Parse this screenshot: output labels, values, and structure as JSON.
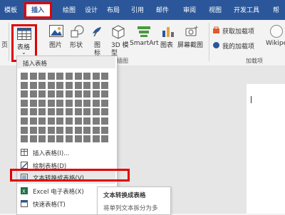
{
  "tabs": [
    {
      "label": "模板"
    },
    {
      "label": "插入"
    },
    {
      "label": "绘图"
    },
    {
      "label": "设计"
    },
    {
      "label": "布局"
    },
    {
      "label": "引用"
    },
    {
      "label": "邮件"
    },
    {
      "label": "审阅"
    },
    {
      "label": "视图"
    },
    {
      "label": "开发工具"
    },
    {
      "label": "帮"
    }
  ],
  "ribbon": {
    "pages_fragment": "页",
    "table": {
      "label": "表格",
      "dropdown_arrow": "⌄"
    },
    "picture": {
      "label": "图片"
    },
    "shapes": {
      "label": "形状"
    },
    "icons": {
      "label": "图",
      "label2": "标"
    },
    "model3d": {
      "label": "3D 模",
      "label2": "型"
    },
    "smartart": {
      "label": "SmartArt"
    },
    "chart": {
      "label": "图表"
    },
    "screenshot": {
      "label": "屏幕截图"
    },
    "get_addins": {
      "label": "获取加载项"
    },
    "my_addins": {
      "label": "我的加载项"
    },
    "wikipedia": {
      "label": "Wikipe"
    },
    "group_illustrations": "插图",
    "group_addins": "加载项"
  },
  "dropdown": {
    "header": "插入表格",
    "grid": {
      "cols": 10,
      "rows": 8
    },
    "items": [
      {
        "label": "插入表格(I)...",
        "icon": "insert-table-icon"
      },
      {
        "label": "绘制表格(D)",
        "icon": "draw-table-icon"
      },
      {
        "label": "文本转换成表格(V)...",
        "icon": "convert-text-icon"
      },
      {
        "label": "Excel 电子表格(X)",
        "icon": "excel-icon"
      },
      {
        "label": "快速表格(T)",
        "icon": "quick-table-icon",
        "arrow": "›"
      }
    ]
  },
  "tooltip": {
    "title": "文本转换成表格",
    "body": "将单列文本拆分为多"
  },
  "colors": {
    "accent": "#2b579a",
    "highlight": "#e00000"
  }
}
